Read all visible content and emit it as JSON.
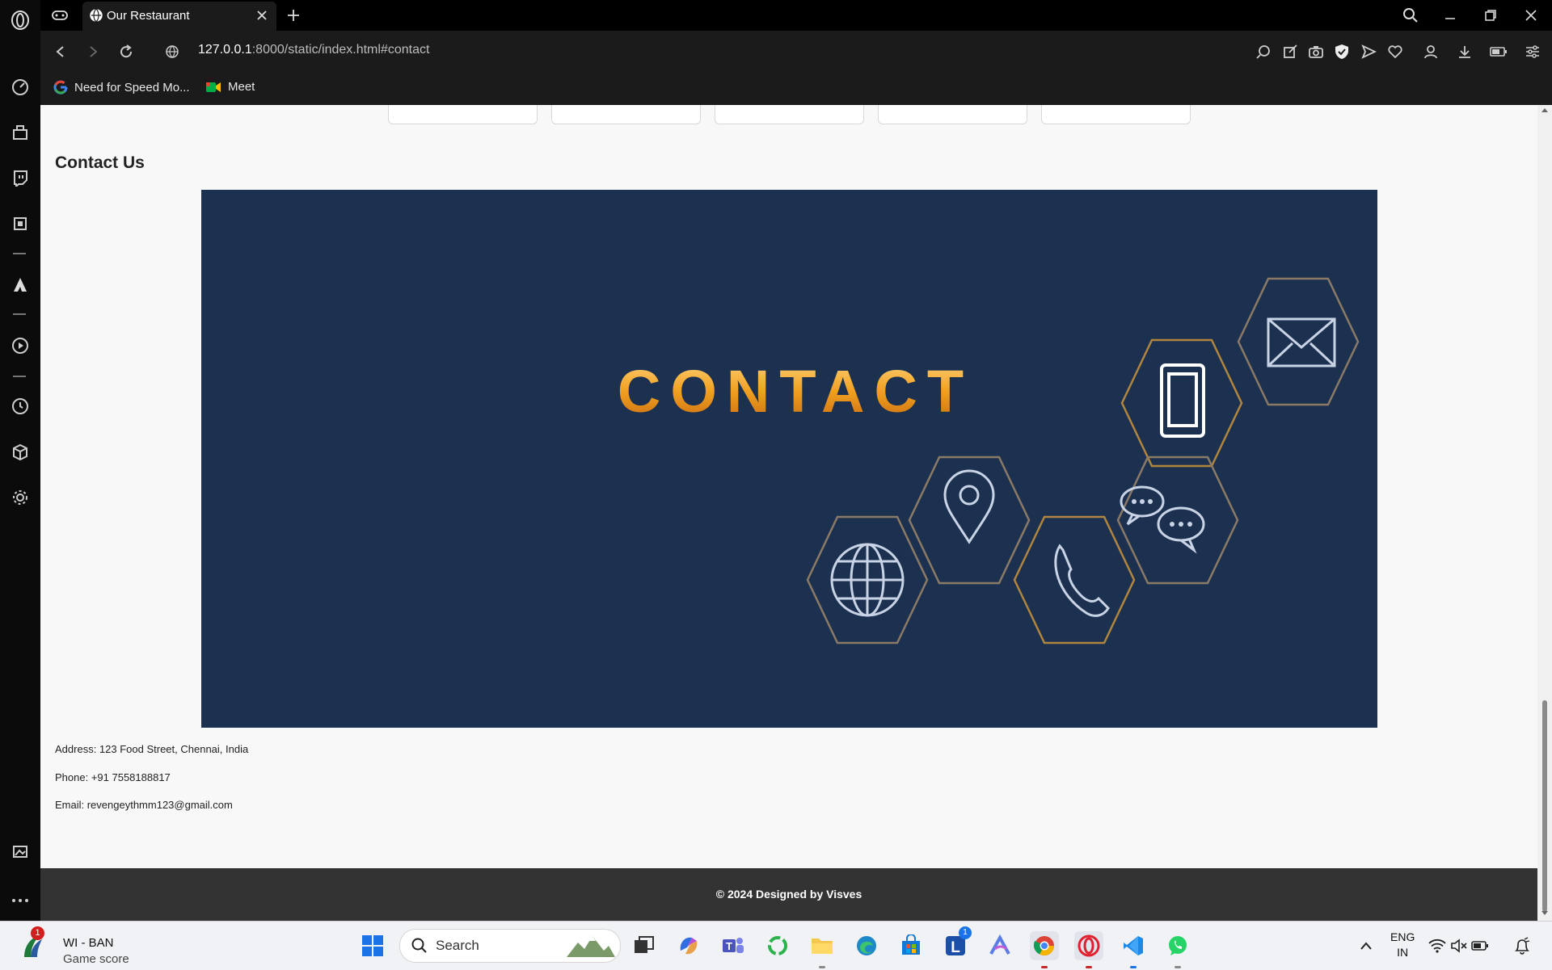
{
  "browser": {
    "tab_title": "Our Restaurant",
    "url_host": "127.0.0.1",
    "url_rest": ":8000/static/index.html#contact",
    "bookmarks": [
      {
        "label": "Need for Speed Mo...",
        "icon": "google-icon"
      },
      {
        "label": "Meet",
        "icon": "meet-icon"
      }
    ]
  },
  "page": {
    "contact_heading": "Contact Us",
    "image": {
      "title": "CONTACT",
      "background": "#1c3150",
      "accent": "#f0a020",
      "hex_icons": [
        "mail-icon",
        "tablet-icon",
        "location-icon",
        "chat-icon",
        "globe-icon",
        "phone-icon"
      ]
    },
    "address": "Address: 123 Food Street, Chennai, India",
    "phone": "Phone: +91 7558188817",
    "email": "Email: revengeythmm123@gmail.com",
    "footer": "© 2024 Designed by Visves"
  },
  "taskbar": {
    "weather_title": "WI - BAN",
    "weather_subtitle": "Game score",
    "weather_badge": "1",
    "search_label": "Search",
    "lang_top": "ENG",
    "lang_bottom": "IN",
    "letter_app_badge": "1"
  }
}
